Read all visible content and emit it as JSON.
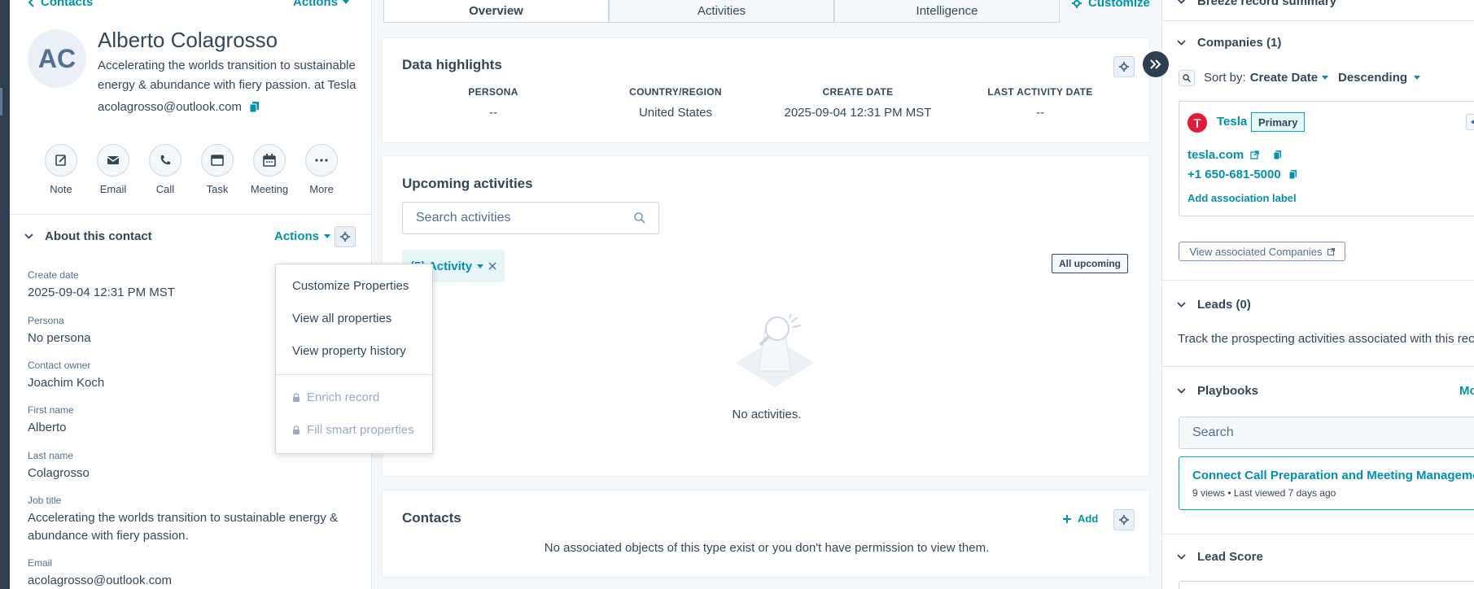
{
  "nav": {
    "back_label": "Contacts",
    "top_actions_label": "Actions"
  },
  "contact": {
    "initials": "AC",
    "name": "Alberto Colagrosso",
    "headline_line1": "Accelerating the worlds transition to sustainable",
    "headline_line2": "energy & abundance with fiery passion. at Tesla",
    "email": "acolagrosso@outlook.com"
  },
  "actions": [
    {
      "label": "Note",
      "icon": "note-icon"
    },
    {
      "label": "Email",
      "icon": "email-icon"
    },
    {
      "label": "Call",
      "icon": "call-icon"
    },
    {
      "label": "Task",
      "icon": "task-icon"
    },
    {
      "label": "Meeting",
      "icon": "meeting-icon"
    },
    {
      "label": "More",
      "icon": "more-icon"
    }
  ],
  "about": {
    "title": "About this contact",
    "actions_label": "Actions",
    "properties": [
      {
        "label": "Create date",
        "value": "2025-09-04 12:31 PM MST"
      },
      {
        "label": "Persona",
        "value": "No persona"
      },
      {
        "label": "Contact owner",
        "value": "Joachim Koch"
      },
      {
        "label": "First name",
        "value": "Alberto"
      },
      {
        "label": "Last name",
        "value": "Colagrosso"
      },
      {
        "label": "Job title",
        "value_line1": "Accelerating the worlds transition to sustainable energy &",
        "value_line2": "abundance with fiery passion."
      },
      {
        "label": "Email",
        "value": "acolagrosso@outlook.com"
      }
    ]
  },
  "dropdown": {
    "items": [
      "Customize Properties",
      "View all properties",
      "View property history"
    ],
    "disabled_items": [
      "Enrich record",
      "Fill smart properties"
    ]
  },
  "tabs": {
    "overview": "Overview",
    "activities": "Activities",
    "intelligence": "Intelligence",
    "customize": "Customize"
  },
  "highlights": {
    "title": "Data highlights",
    "columns": [
      {
        "head": "PERSONA",
        "value": "--"
      },
      {
        "head": "COUNTRY/REGION",
        "value": "United States"
      },
      {
        "head": "CREATE DATE",
        "value": "2025-09-04 12:31 PM MST"
      },
      {
        "head": "LAST ACTIVITY DATE",
        "value": "--"
      }
    ]
  },
  "upcoming": {
    "title": "Upcoming activities",
    "search_placeholder": "Search activities",
    "filter_label": "(5) Activity",
    "all_upcoming": "All upcoming",
    "empty": "No activities."
  },
  "contacts_card": {
    "title": "Contacts",
    "add_label": "Add",
    "empty": "No associated objects of this type exist or you don't have permission to view them."
  },
  "right": {
    "top_section": "Breeze record summary",
    "companies": {
      "title": "Companies (1)",
      "sort_prefix": "Sort by:",
      "sort_by": "Create Date",
      "sort_dir": "Descending",
      "company_name": "Tesla",
      "primary_badge": "Primary",
      "domain": "tesla.com",
      "phone": "+1 650-681-5000",
      "add_label": "Add association label",
      "view_all": "View associated Companies"
    },
    "leads": {
      "title": "Leads (0)",
      "description": "Track the prospecting activities associated with this rec"
    },
    "playbooks": {
      "title": "Playbooks",
      "more": "Mo",
      "search_placeholder": "Search",
      "item_title": "Connect Call Preparation and Meeting Manageme",
      "item_meta": "9 views • Last viewed 7 days ago"
    },
    "lead_score": {
      "title": "Lead Score"
    }
  },
  "colors": {
    "accent": "#0091ae",
    "text": "#33475b",
    "tesla": "#e31937",
    "nav": "#2d3e50"
  }
}
